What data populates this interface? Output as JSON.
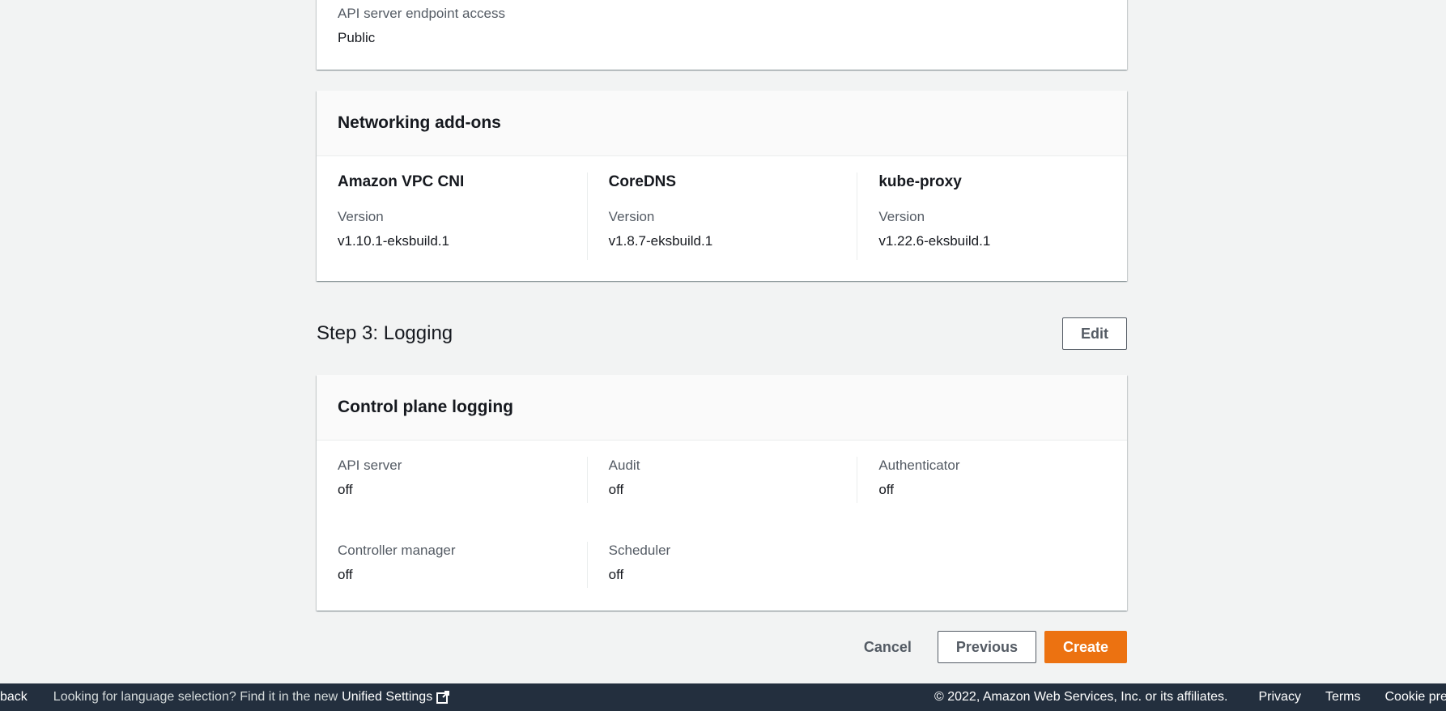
{
  "endpoint": {
    "label": "API server endpoint access",
    "value": "Public"
  },
  "addons": {
    "title": "Networking add-ons",
    "items": [
      {
        "name": "Amazon VPC CNI",
        "version_label": "Version",
        "version": "v1.10.1-eksbuild.1"
      },
      {
        "name": "CoreDNS",
        "version_label": "Version",
        "version": "v1.8.7-eksbuild.1"
      },
      {
        "name": "kube-proxy",
        "version_label": "Version",
        "version": "v1.22.6-eksbuild.1"
      }
    ]
  },
  "step3": {
    "title": "Step 3: Logging",
    "edit_label": "Edit"
  },
  "logging": {
    "title": "Control plane logging",
    "items": [
      {
        "label": "API server",
        "value": "off"
      },
      {
        "label": "Audit",
        "value": "off"
      },
      {
        "label": "Authenticator",
        "value": "off"
      },
      {
        "label": "Controller manager",
        "value": "off"
      },
      {
        "label": "Scheduler",
        "value": "off"
      }
    ]
  },
  "actions": {
    "cancel": "Cancel",
    "previous": "Previous",
    "create": "Create"
  },
  "footer": {
    "feedback": "back",
    "language_prompt": "Looking for language selection? Find it in the new",
    "unified_settings": "Unified Settings",
    "copyright": "© 2022, Amazon Web Services, Inc. or its affiliates.",
    "privacy": "Privacy",
    "terms": "Terms",
    "cookies": "Cookie prefere"
  },
  "colors": {
    "background": "#f2f3f3",
    "primary": "#ec7211",
    "footer": "#232f3e"
  },
  "icons": {
    "external_link": "external-link-icon"
  }
}
